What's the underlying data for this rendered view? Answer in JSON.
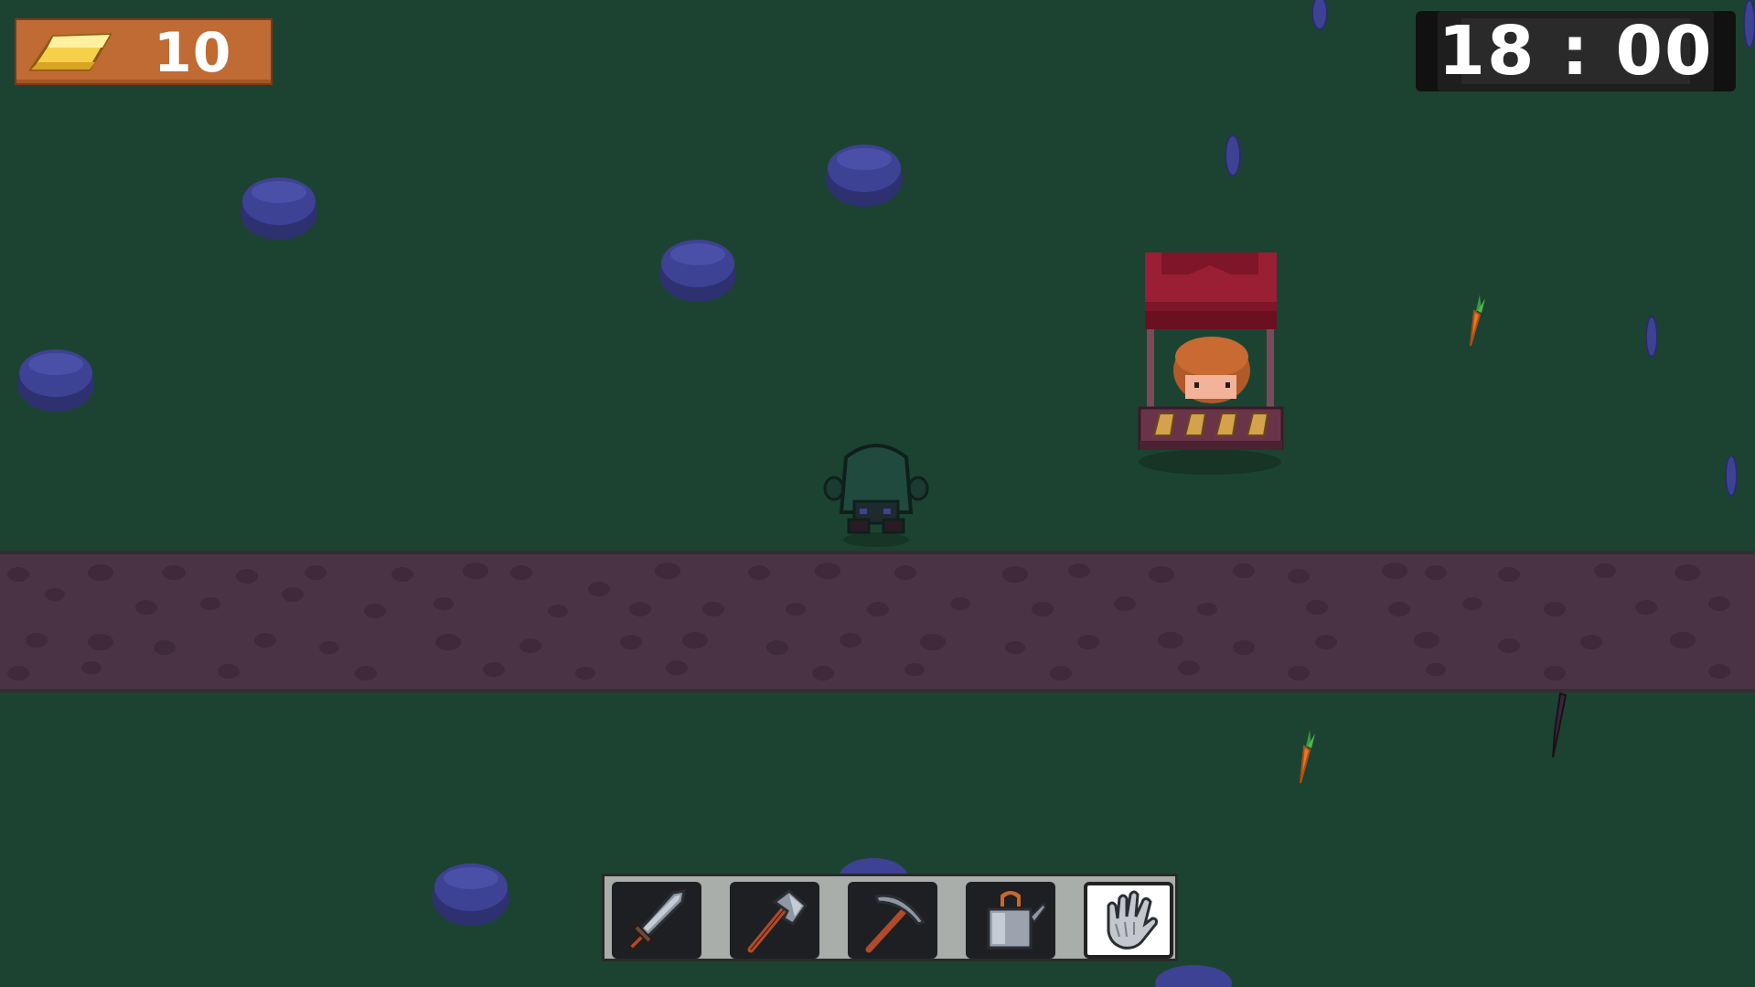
{
  "hud": {
    "gold": {
      "icon": "gold-bar-icon",
      "amount": "10"
    },
    "clock": {
      "time": "18 : 00"
    }
  },
  "toolbar": {
    "slots": [
      {
        "icon": "sword-icon",
        "selected": false
      },
      {
        "icon": "axe-icon",
        "selected": false
      },
      {
        "icon": "pickaxe-icon",
        "selected": false
      },
      {
        "icon": "watering-can-icon",
        "selected": false
      },
      {
        "icon": "hand-icon",
        "selected": true
      }
    ]
  },
  "colors": {
    "grass": "#1c4332",
    "path": "#4b3545",
    "stump": "#3b3f8f",
    "stall_roof": "#8a1a2a",
    "gold_panel": "#c06a34",
    "selected_slot": "#ffffff"
  }
}
